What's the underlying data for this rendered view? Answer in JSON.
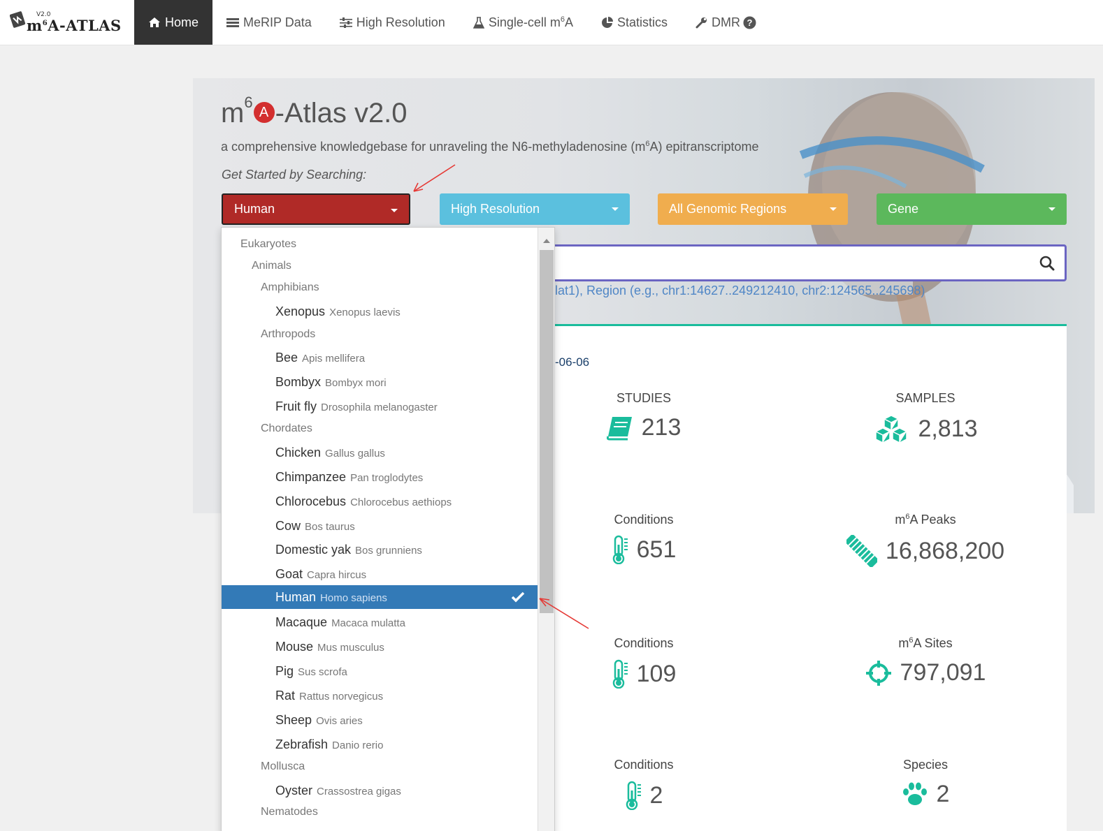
{
  "brand": {
    "version": "V2.0",
    "name_prefix": "m",
    "name_sup": "6",
    "name_suffix": "A-ATLAS"
  },
  "nav": [
    {
      "label": "Home",
      "icon": "home-icon"
    },
    {
      "label": "MeRIP Data",
      "icon": "list-icon"
    },
    {
      "label": "High Resolution",
      "icon": "sliders-icon"
    },
    {
      "label": "Single-cell m",
      "sup": "6",
      "suffix": "A",
      "icon": "flask-icon"
    },
    {
      "label": "Statistics",
      "icon": "pie-chart-icon"
    },
    {
      "label": "DMR",
      "icon": "wrench-icon",
      "extra_icon": "question-circle-icon"
    }
  ],
  "hero": {
    "title_prefix": "m",
    "title_sup": "6",
    "title_letter": "A",
    "title_suffix": "-Atlas v2.0",
    "subtitle_prefix": "a comprehensive knowledgebase for unraveling the N6-methyladenosine (m",
    "subtitle_sup": "6",
    "subtitle_suffix": "A) epitranscriptome",
    "get_started": "Get Started by Searching:"
  },
  "selects": {
    "species": "Human",
    "resolution": "High Resolution",
    "region": "All Genomic Regions",
    "type": "Gene"
  },
  "search": {
    "hint": "lat1), Region (e.g., chr1:14627..249212410, chr2:124565..245698)"
  },
  "stats": {
    "date": "-06-06",
    "items": [
      {
        "label": "STUDIES",
        "value": "213",
        "icon": "book-icon"
      },
      {
        "label": "SAMPLES",
        "value": "2,813",
        "icon": "cubes-icon"
      },
      {
        "label": "Conditions",
        "value": "651",
        "icon": "thermometer-icon"
      },
      {
        "label_prefix": "m",
        "label_sup": "6",
        "label_suffix": "A Peaks",
        "value": "16,868,200",
        "icon": "dna-icon"
      },
      {
        "label": "Conditions",
        "value": "109",
        "icon": "thermometer-icon"
      },
      {
        "label_prefix": "m",
        "label_sup": "6",
        "label_suffix": "A Sites",
        "value": "797,091",
        "icon": "crosshairs-icon"
      },
      {
        "label": "Conditions",
        "value": "2",
        "icon": "thermometer-icon"
      },
      {
        "label": "Species",
        "value": "2",
        "icon": "paw-icon"
      }
    ]
  },
  "dropdown": {
    "items": [
      {
        "type": "group",
        "level": 0,
        "label": "Eukaryotes"
      },
      {
        "type": "group",
        "level": 1,
        "label": "Animals"
      },
      {
        "type": "group",
        "level": 2,
        "label": "Amphibians"
      },
      {
        "type": "option",
        "common": "Xenopus",
        "sci": "Xenopus laevis"
      },
      {
        "type": "group",
        "level": 2,
        "label": "Arthropods"
      },
      {
        "type": "option",
        "common": "Bee",
        "sci": "Apis mellifera"
      },
      {
        "type": "option",
        "common": "Bombyx",
        "sci": "Bombyx mori"
      },
      {
        "type": "option",
        "common": "Fruit fly",
        "sci": "Drosophila melanogaster"
      },
      {
        "type": "group",
        "level": 2,
        "label": "Chordates"
      },
      {
        "type": "option",
        "common": "Chicken",
        "sci": "Gallus gallus"
      },
      {
        "type": "option",
        "common": "Chimpanzee",
        "sci": "Pan troglodytes"
      },
      {
        "type": "option",
        "common": "Chlorocebus",
        "sci": "Chlorocebus aethiops"
      },
      {
        "type": "option",
        "common": "Cow",
        "sci": "Bos taurus"
      },
      {
        "type": "option",
        "common": "Domestic yak",
        "sci": "Bos grunniens"
      },
      {
        "type": "option",
        "common": "Goat",
        "sci": "Capra hircus"
      },
      {
        "type": "option",
        "common": "Human",
        "sci": "Homo sapiens",
        "selected": true
      },
      {
        "type": "option",
        "common": "Macaque",
        "sci": "Macaca mulatta"
      },
      {
        "type": "option",
        "common": "Mouse",
        "sci": "Mus musculus"
      },
      {
        "type": "option",
        "common": "Pig",
        "sci": "Sus scrofa"
      },
      {
        "type": "option",
        "common": "Rat",
        "sci": "Rattus norvegicus"
      },
      {
        "type": "option",
        "common": "Sheep",
        "sci": "Ovis aries"
      },
      {
        "type": "option",
        "common": "Zebrafish",
        "sci": "Danio rerio"
      },
      {
        "type": "group",
        "level": 2,
        "label": "Mollusca"
      },
      {
        "type": "option",
        "common": "Oyster",
        "sci": "Crassostrea gigas"
      },
      {
        "type": "group",
        "level": 2,
        "label": "Nematodes"
      }
    ]
  },
  "colors": {
    "accent_teal": "#1abc9c",
    "human_red": "#b02a27",
    "resolution_blue": "#5bc0de",
    "region_orange": "#f0ad4e",
    "gene_green": "#5cb85c",
    "selected_blue": "#337ab7",
    "annotation_arrow": "#e53935"
  }
}
